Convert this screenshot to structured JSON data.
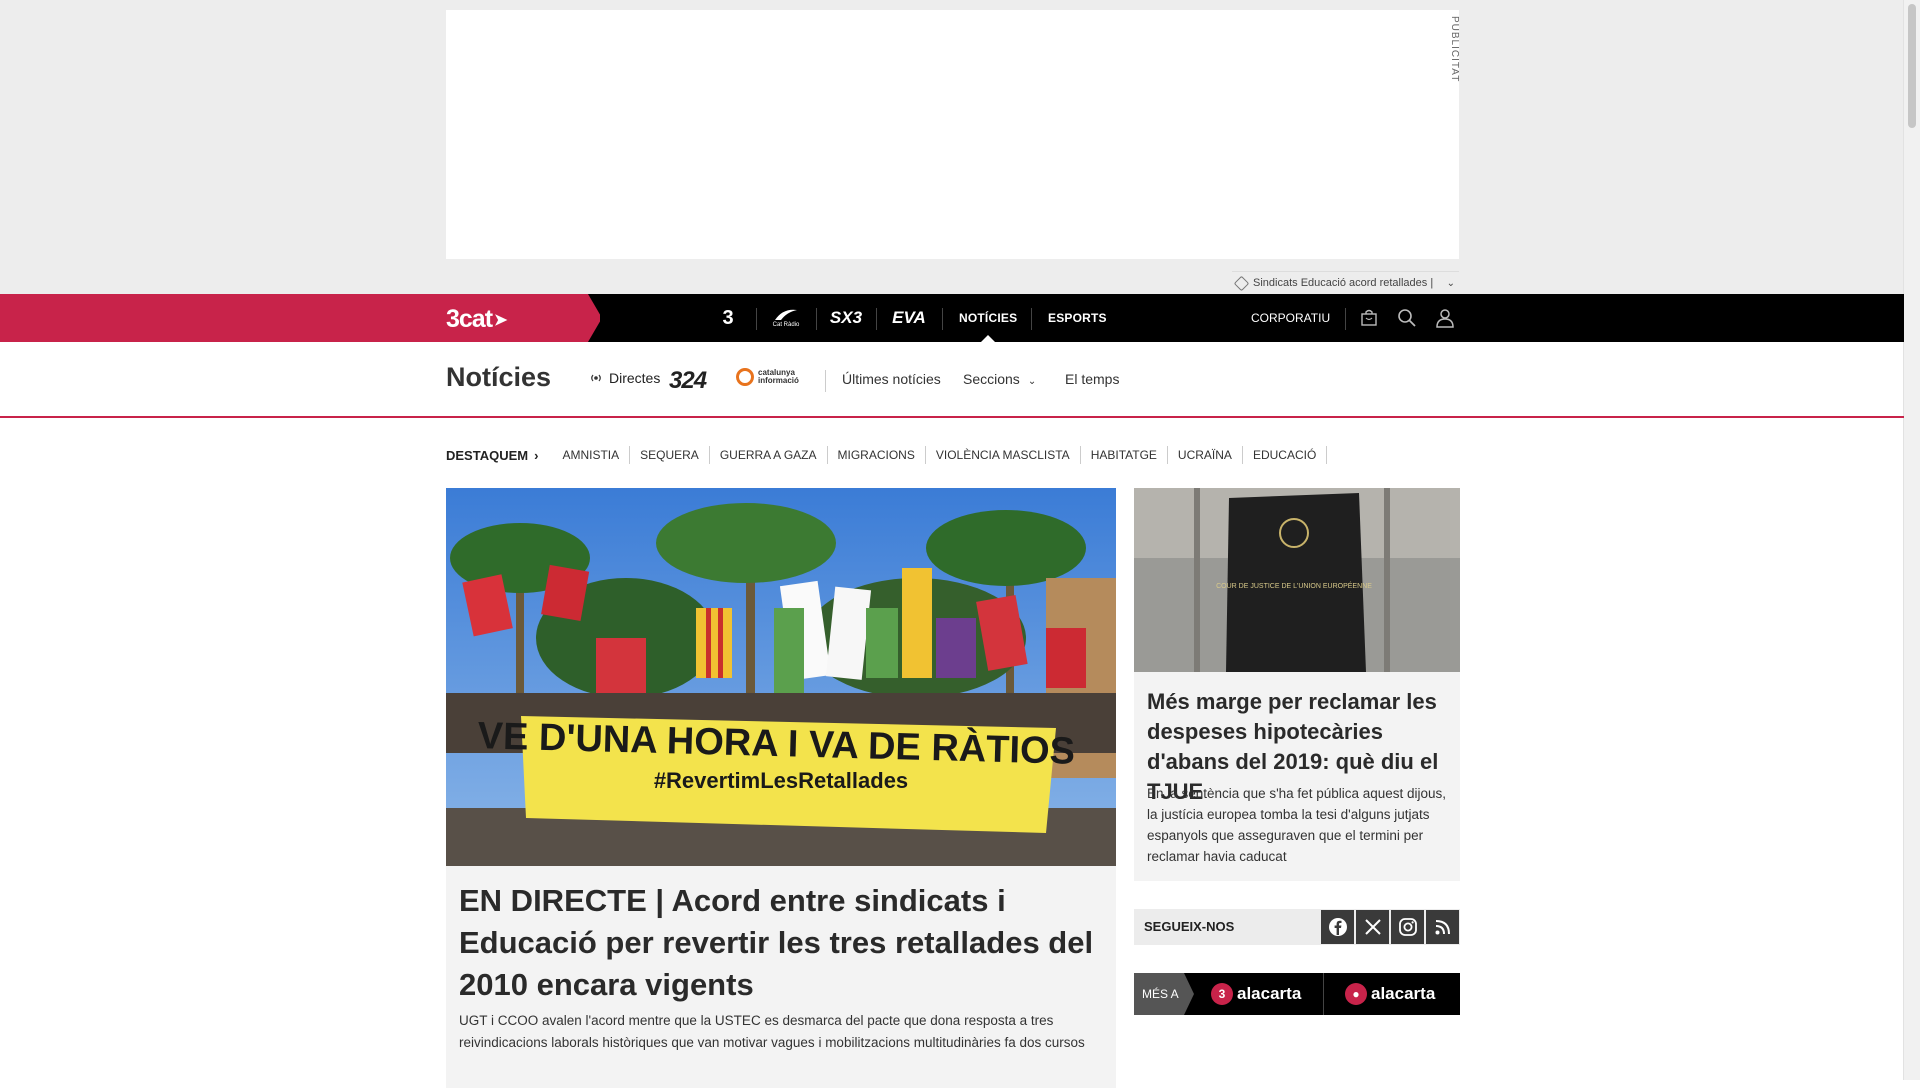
{
  "ad": {
    "label": "PUBLICITAT",
    "topic_tags": "Sindicats  Educació  acord retallades  |"
  },
  "topnav": {
    "brand": "3cat",
    "channels": [
      "3",
      "Cat Ràdio",
      "SX3",
      "EVA"
    ],
    "items": [
      "NOTÍCIES",
      "ESPORTS"
    ],
    "corporate": "CORPORATIU",
    "icons": [
      "shop-bag-icon",
      "search-icon",
      "user-icon"
    ],
    "accent_color": "#c8234a"
  },
  "section": {
    "title": "Notícies",
    "live_label": "Directes",
    "logo_324": "324",
    "logo_cat_info_line1": "catalunya",
    "logo_cat_info_line2": "informació",
    "links": [
      "Últimes notícies",
      "Seccions",
      "El temps"
    ]
  },
  "destaquem": {
    "label": "DESTAQUEM",
    "tags": [
      "AMNISTIA",
      "SEQUERA",
      "GUERRA A GAZA",
      "MIGRACIONS",
      "VIOLÈNCIA MASCLISTA",
      "HABITATGE",
      "UCRAÏNA",
      "EDUCACIÓ"
    ]
  },
  "main_story": {
    "image_banner": "VE D'UNA HORA I VA DE RÀTIOS",
    "image_hashtag": "#RevertimLesRetallades",
    "headline": "EN DIRECTE | Acord entre sindicats i Educació per revertir les tres retallades del 2010 encara vigents",
    "summary": "UGT i CCOO avalen l'acord mentre que la USTEC es desmarca del pacte que dona resposta a tres reivindicacions laborals històriques que van motivar vagues i mobilitzacions multitudinàries fa dos cursos"
  },
  "side_story": {
    "image_sign": "COUR DE JUSTICE DE L'UNION EUROPÉENNE",
    "headline": "Més marge per reclamar les despeses hipotecàries d'abans del 2019: què diu el TJUE",
    "summary": "En la sentència que s'ha fet pública aquest dijous, la justícia europea tomba la tesi d'alguns jutjats espanyols que asseguraven que el termini per reclamar havia caducat"
  },
  "follow": {
    "label": "SEGUEIX-NOS",
    "networks": [
      "facebook-icon",
      "x-icon",
      "instagram-icon",
      "rss-icon"
    ]
  },
  "more": {
    "label": "MÉS A",
    "link1": "alacarta",
    "link2": "alacarta"
  }
}
